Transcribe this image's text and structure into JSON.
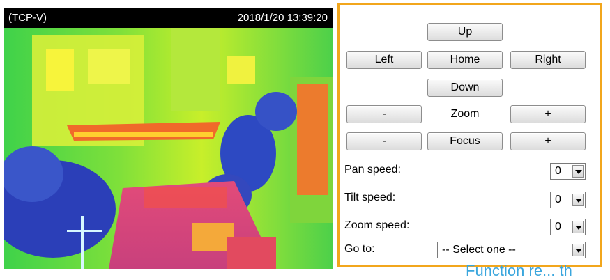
{
  "video": {
    "channel": "(TCP-V)",
    "timestamp": "2018/1/20 13:39:20"
  },
  "controls": {
    "up_label": "Up",
    "left_label": "Left",
    "home_label": "Home",
    "right_label": "Right",
    "down_label": "Down",
    "zoom_minus_label": "-",
    "zoom_label": "Zoom",
    "zoom_plus_label": "+",
    "focus_minus_label": "-",
    "focus_label": "Focus",
    "focus_plus_label": "+",
    "pan_speed_label": "Pan speed:",
    "pan_speed_value": "0",
    "tilt_speed_label": "Tilt speed:",
    "tilt_speed_value": "0",
    "zoom_speed_label": "Zoom speed:",
    "zoom_speed_value": "0",
    "goto_label": "Go to:",
    "goto_value": "-- Select one --"
  },
  "footer": {
    "caption": "Function re... th"
  },
  "colors": {
    "panel_border": "#f2a61c",
    "caption": "#3aa6dd"
  }
}
